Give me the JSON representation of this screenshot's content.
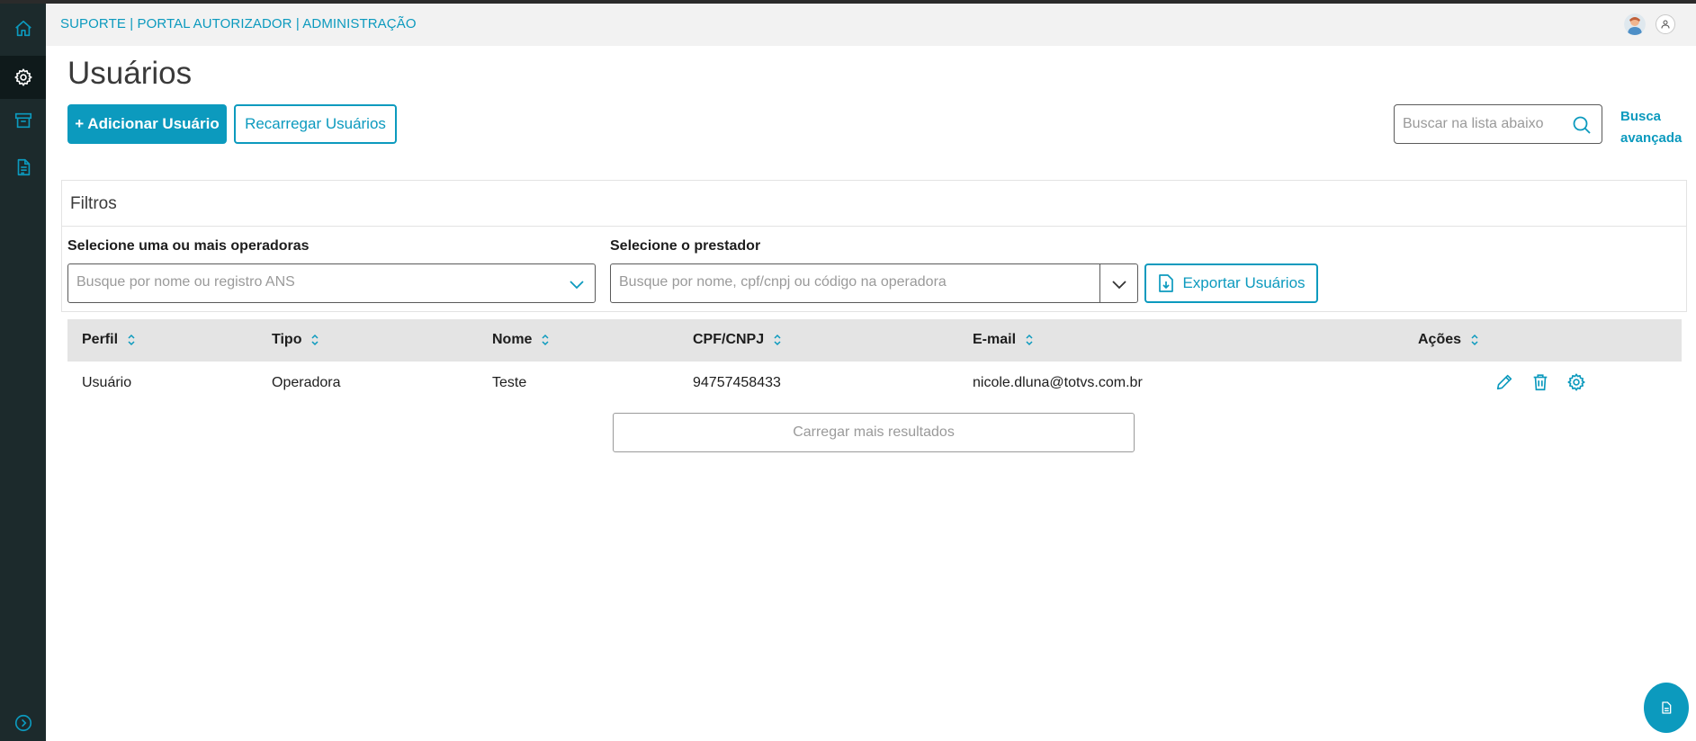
{
  "header": {
    "breadcrumb": "SUPORTE | PORTAL AUTORIZADOR | ADMINISTRAÇÃO"
  },
  "sidebar": {
    "items": [
      {
        "icon": "home-icon",
        "label": "Home"
      },
      {
        "icon": "gear-icon",
        "label": "Settings",
        "active": true
      },
      {
        "icon": "archive-icon",
        "label": "Archive"
      },
      {
        "icon": "document-icon",
        "label": "Documents"
      }
    ],
    "expand_icon": "chevron-right-circle-icon"
  },
  "page": {
    "title": "Usuários",
    "add_button": "+ Adicionar Usuário",
    "reload_button": "Recarregar Usuários",
    "search_placeholder": "Buscar na lista abaixo",
    "advanced_search": "Busca avançada"
  },
  "filters": {
    "title": "Filtros",
    "operators_label": "Selecione uma ou mais operadoras",
    "operators_placeholder": "Busque por nome ou registro ANS",
    "provider_label": "Selecione o prestador",
    "provider_placeholder": "Busque por nome, cpf/cnpj ou código na operadora",
    "export_button": "Exportar Usuários"
  },
  "table": {
    "columns": [
      "Perfil",
      "Tipo",
      "Nome",
      "CPF/CNPJ",
      "E-mail",
      "Ações"
    ],
    "rows": [
      {
        "perfil": "Usuário",
        "tipo": "Operadora",
        "nome": "Teste",
        "cpf_cnpj": "94757458433",
        "email": "nicole.dluna@totvs.com.br"
      }
    ],
    "load_more": "Carregar mais resultados"
  },
  "colors": {
    "accent": "#0c9abe",
    "sidebar_bg": "#1c2a2c",
    "header_bg": "#f2f2f2",
    "table_header_bg": "#e4e4e4"
  }
}
